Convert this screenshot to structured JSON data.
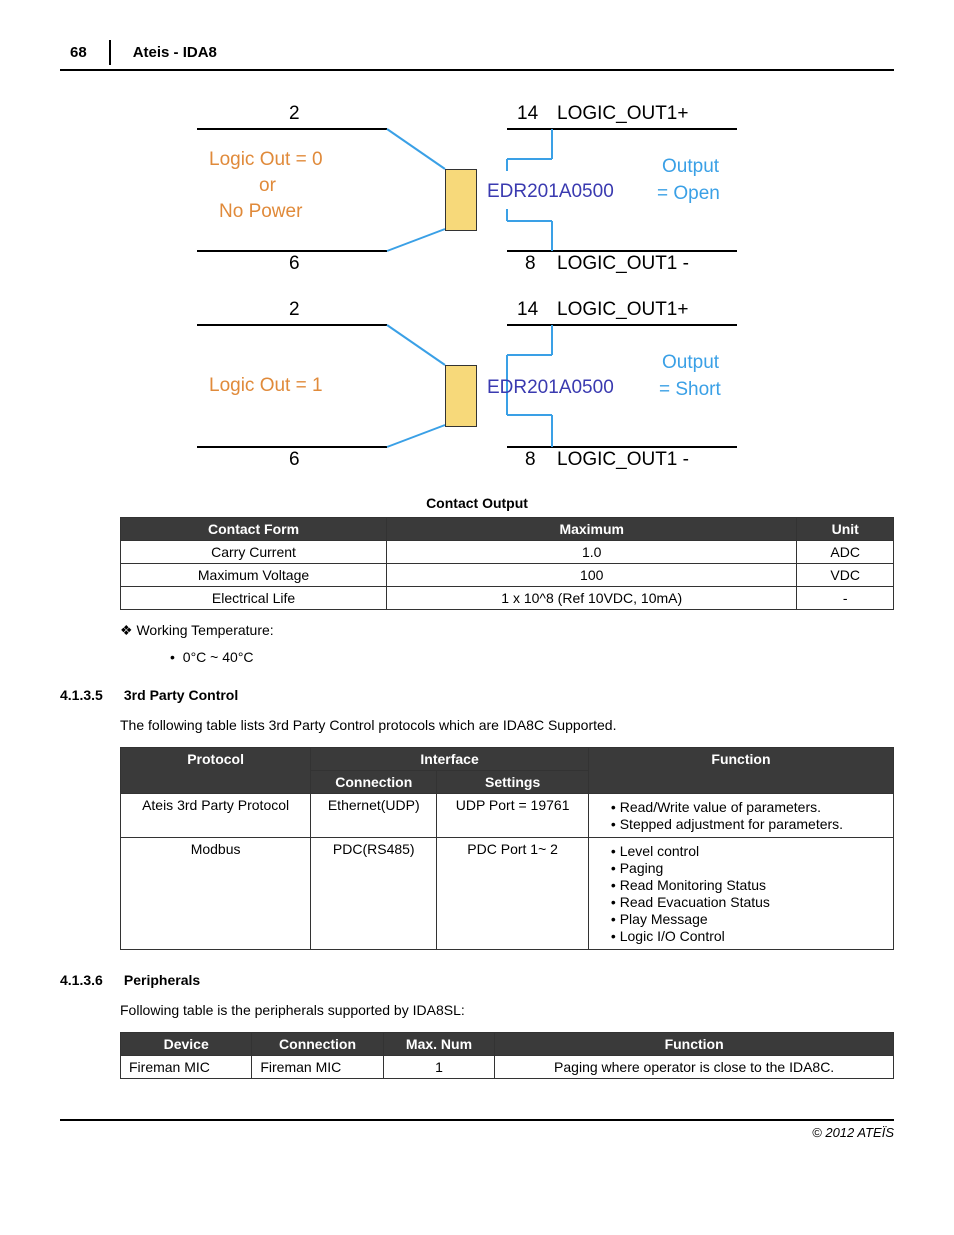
{
  "header": {
    "page_number": "68",
    "title": "Ateis - IDA8"
  },
  "diagram1": {
    "pin2": "2",
    "pin6": "6",
    "pin14": "14",
    "pin8": "8",
    "left_line1": "Logic Out = 0",
    "left_line2": "or",
    "left_line3": "No Power",
    "chip": "EDR201A0500",
    "out_line1": "Output",
    "out_line2": "= Open",
    "sig_hi": "LOGIC_OUT1+",
    "sig_lo": "LOGIC_OUT1 -"
  },
  "diagram2": {
    "pin2": "2",
    "pin6": "6",
    "pin14": "14",
    "pin8": "8",
    "left_line1": "Logic Out = 1",
    "chip": "EDR201A0500",
    "out_line1": "Output",
    "out_line2": "= Short",
    "sig_hi": "LOGIC_OUT1+",
    "sig_lo": "LOGIC_OUT1 -"
  },
  "caption": "Contact Output",
  "table_contact": {
    "headers": [
      "Contact Form",
      "Maximum",
      "Unit"
    ],
    "rows": [
      [
        "Carry Current",
        "1.0",
        "ADC"
      ],
      [
        "Maximum Voltage",
        "100",
        "VDC"
      ],
      [
        "Electrical Life",
        "1 x 10^8 (Ref 10VDC, 10mA)",
        "-"
      ]
    ]
  },
  "working_temp_label": "Working Temperature:",
  "working_temp_value": "0°C ~ 40°C",
  "section_435": {
    "num": "4.1.3.5",
    "title": "3rd Party Control",
    "intro": "The following table lists 3rd Party Control protocols which are IDA8C Supported."
  },
  "table_3rd": {
    "h_protocol": "Protocol",
    "h_interface": "Interface",
    "h_connection": "Connection",
    "h_settings": "Settings",
    "h_function": "Function",
    "r1": {
      "protocol": "Ateis 3rd Party Protocol",
      "connection": "Ethernet(UDP)",
      "settings": "UDP Port = 19761",
      "functions": [
        "Read/Write value of parameters.",
        "Stepped adjustment for parameters."
      ]
    },
    "r2": {
      "protocol": "Modbus",
      "connection": "PDC(RS485)",
      "settings": "PDC Port 1~ 2",
      "functions": [
        "Level control",
        "Paging",
        "Read Monitoring Status",
        "Read Evacuation Status",
        "Play Message",
        "Logic I/O Control"
      ]
    }
  },
  "section_436": {
    "num": "4.1.3.6",
    "title": "Peripherals",
    "intro": "Following table is the peripherals supported by IDA8SL:"
  },
  "table_periph": {
    "headers": [
      "Device",
      "Connection",
      "Max. Num",
      "Function"
    ],
    "rows": [
      [
        "Fireman MIC",
        "Fireman MIC",
        "1",
        "Paging where operator is close to the IDA8C."
      ]
    ]
  },
  "footer": "© 2012 ATEÏS"
}
